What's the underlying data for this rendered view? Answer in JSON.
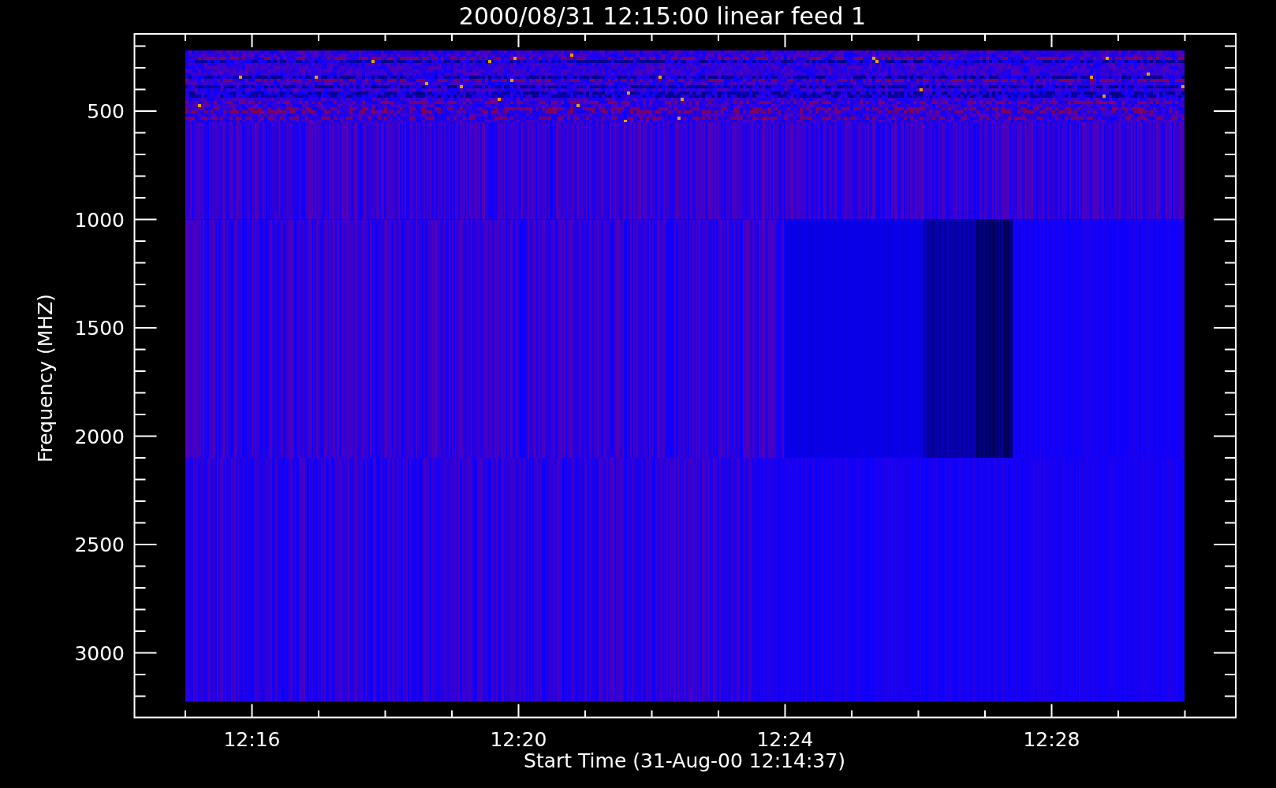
{
  "plot": {
    "title": "2000/08/31 12:15:00 linear feed 1",
    "ylabel": "Frequency (MHZ)",
    "xlabel": "Start Time (31-Aug-00 12:14:37)",
    "yticks": [
      "500",
      "1000",
      "1500",
      "2000",
      "2500",
      "3000"
    ],
    "xticks": [
      "12:16",
      "12:20",
      "12:24",
      "12:28"
    ]
  }
}
